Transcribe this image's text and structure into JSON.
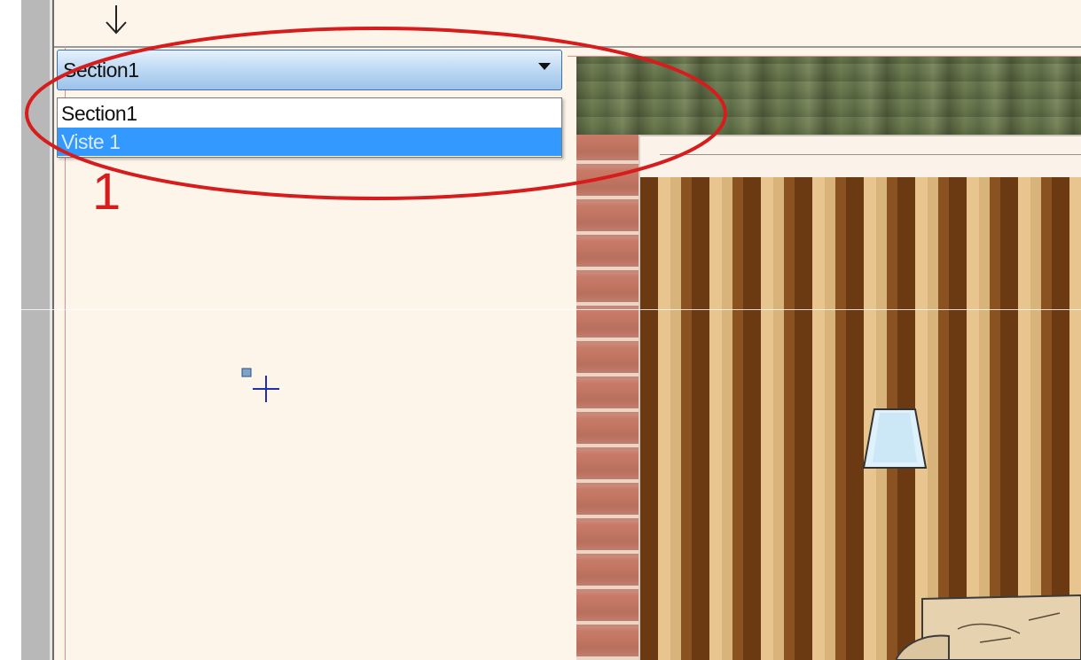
{
  "section_dropdown": {
    "selected_value": "Section1",
    "options": [
      "Section1",
      "Viste 1"
    ]
  },
  "annotation": {
    "label": "1"
  },
  "colors": {
    "accent_blue": "#3399ff",
    "annotation_red": "#d61c1c"
  }
}
